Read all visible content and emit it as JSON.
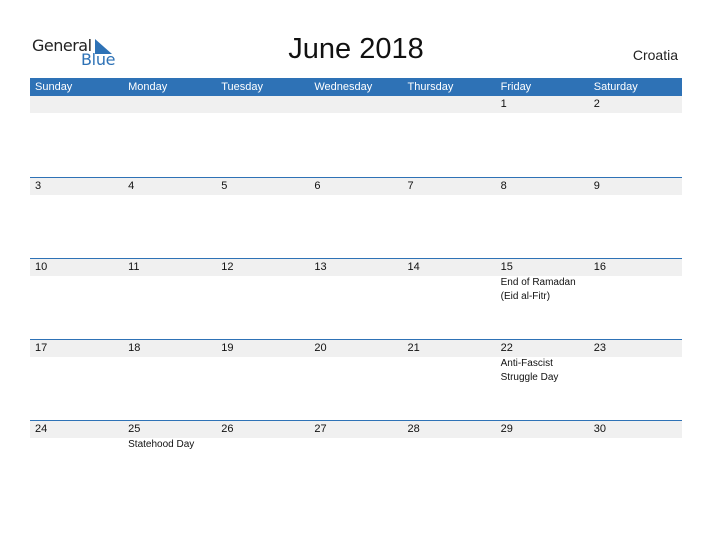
{
  "logo": {
    "general": "General",
    "blue": "Blue",
    "icon": "triangle-flag-icon"
  },
  "title": "June 2018",
  "country": "Croatia",
  "colors": {
    "accent": "#2e72b6",
    "band": "#f0f0f0"
  },
  "weekdays": [
    "Sunday",
    "Monday",
    "Tuesday",
    "Wednesday",
    "Thursday",
    "Friday",
    "Saturday"
  ],
  "weeks": [
    {
      "days": [
        {
          "num": "",
          "event": ""
        },
        {
          "num": "",
          "event": ""
        },
        {
          "num": "",
          "event": ""
        },
        {
          "num": "",
          "event": ""
        },
        {
          "num": "",
          "event": ""
        },
        {
          "num": "1",
          "event": ""
        },
        {
          "num": "2",
          "event": ""
        }
      ]
    },
    {
      "days": [
        {
          "num": "3",
          "event": ""
        },
        {
          "num": "4",
          "event": ""
        },
        {
          "num": "5",
          "event": ""
        },
        {
          "num": "6",
          "event": ""
        },
        {
          "num": "7",
          "event": ""
        },
        {
          "num": "8",
          "event": ""
        },
        {
          "num": "9",
          "event": ""
        }
      ]
    },
    {
      "days": [
        {
          "num": "10",
          "event": ""
        },
        {
          "num": "11",
          "event": ""
        },
        {
          "num": "12",
          "event": ""
        },
        {
          "num": "13",
          "event": ""
        },
        {
          "num": "14",
          "event": ""
        },
        {
          "num": "15",
          "event": "End of Ramadan",
          "event2": "(Eid al-Fitr)"
        },
        {
          "num": "16",
          "event": ""
        }
      ]
    },
    {
      "days": [
        {
          "num": "17",
          "event": ""
        },
        {
          "num": "18",
          "event": ""
        },
        {
          "num": "19",
          "event": ""
        },
        {
          "num": "20",
          "event": ""
        },
        {
          "num": "21",
          "event": ""
        },
        {
          "num": "22",
          "event": "Anti-Fascist",
          "event2": "Struggle Day"
        },
        {
          "num": "23",
          "event": ""
        }
      ]
    },
    {
      "days": [
        {
          "num": "24",
          "event": ""
        },
        {
          "num": "25",
          "event": "Statehood Day"
        },
        {
          "num": "26",
          "event": ""
        },
        {
          "num": "27",
          "event": ""
        },
        {
          "num": "28",
          "event": ""
        },
        {
          "num": "29",
          "event": ""
        },
        {
          "num": "30",
          "event": ""
        }
      ]
    }
  ]
}
